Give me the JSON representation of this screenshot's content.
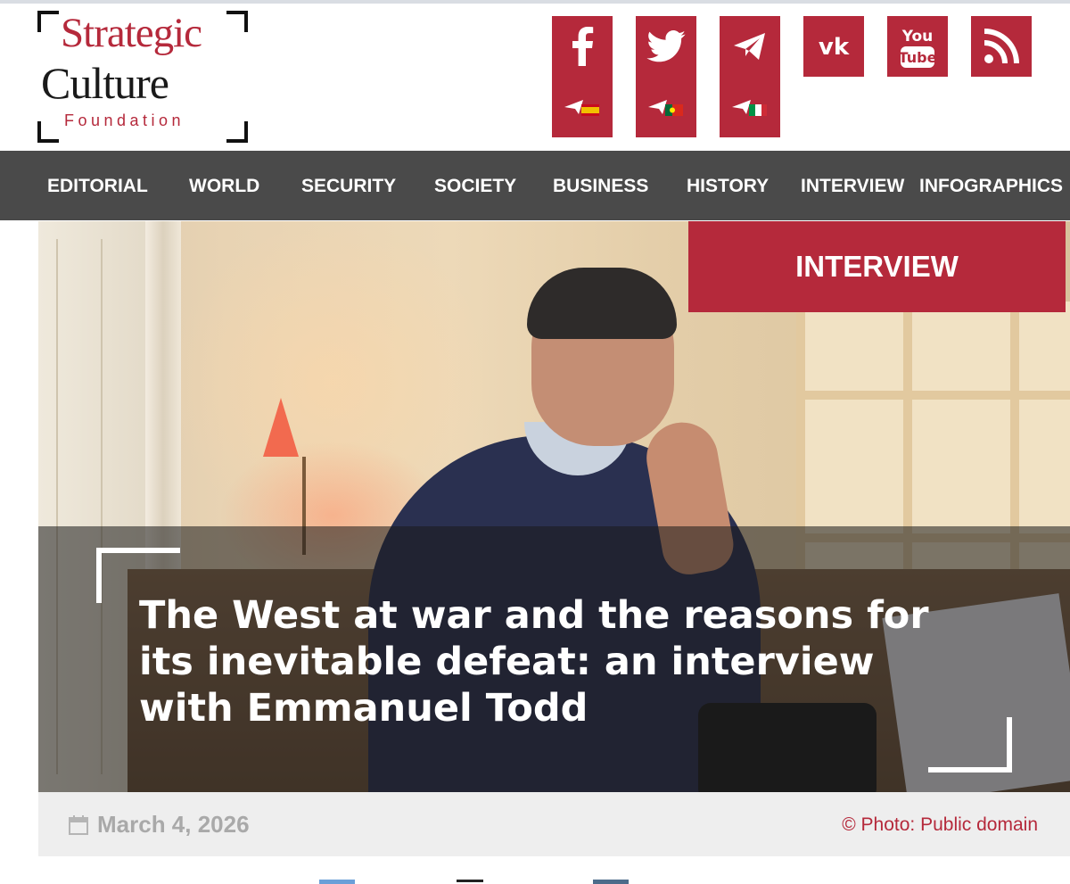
{
  "logo": {
    "line1": "Strategic",
    "line2": "Culture",
    "line3": "Foundation"
  },
  "social": {
    "color": "#b5293b",
    "icons": [
      "facebook-icon",
      "twitter-icon",
      "telegram-icon",
      "vk-icon",
      "youtube-icon",
      "rss-icon"
    ],
    "sub_icons": [
      "telegram-es-icon",
      "telegram-pt-icon",
      "telegram-it-icon"
    ],
    "youtube_top": "You",
    "youtube_bottom": "Tube"
  },
  "nav": {
    "items": [
      "EDITORIAL",
      "WORLD",
      "SECURITY",
      "SOCIETY",
      "BUSINESS",
      "HISTORY",
      "INTERVIEW",
      "INFOGRAPHICS"
    ]
  },
  "article": {
    "category": "INTERVIEW",
    "title": "The West at war and the reasons for its inevitable defeat: an interview with Emmanuel Todd",
    "date": "March 4, 2026",
    "photo_credit": "© Photo: Public domain"
  }
}
